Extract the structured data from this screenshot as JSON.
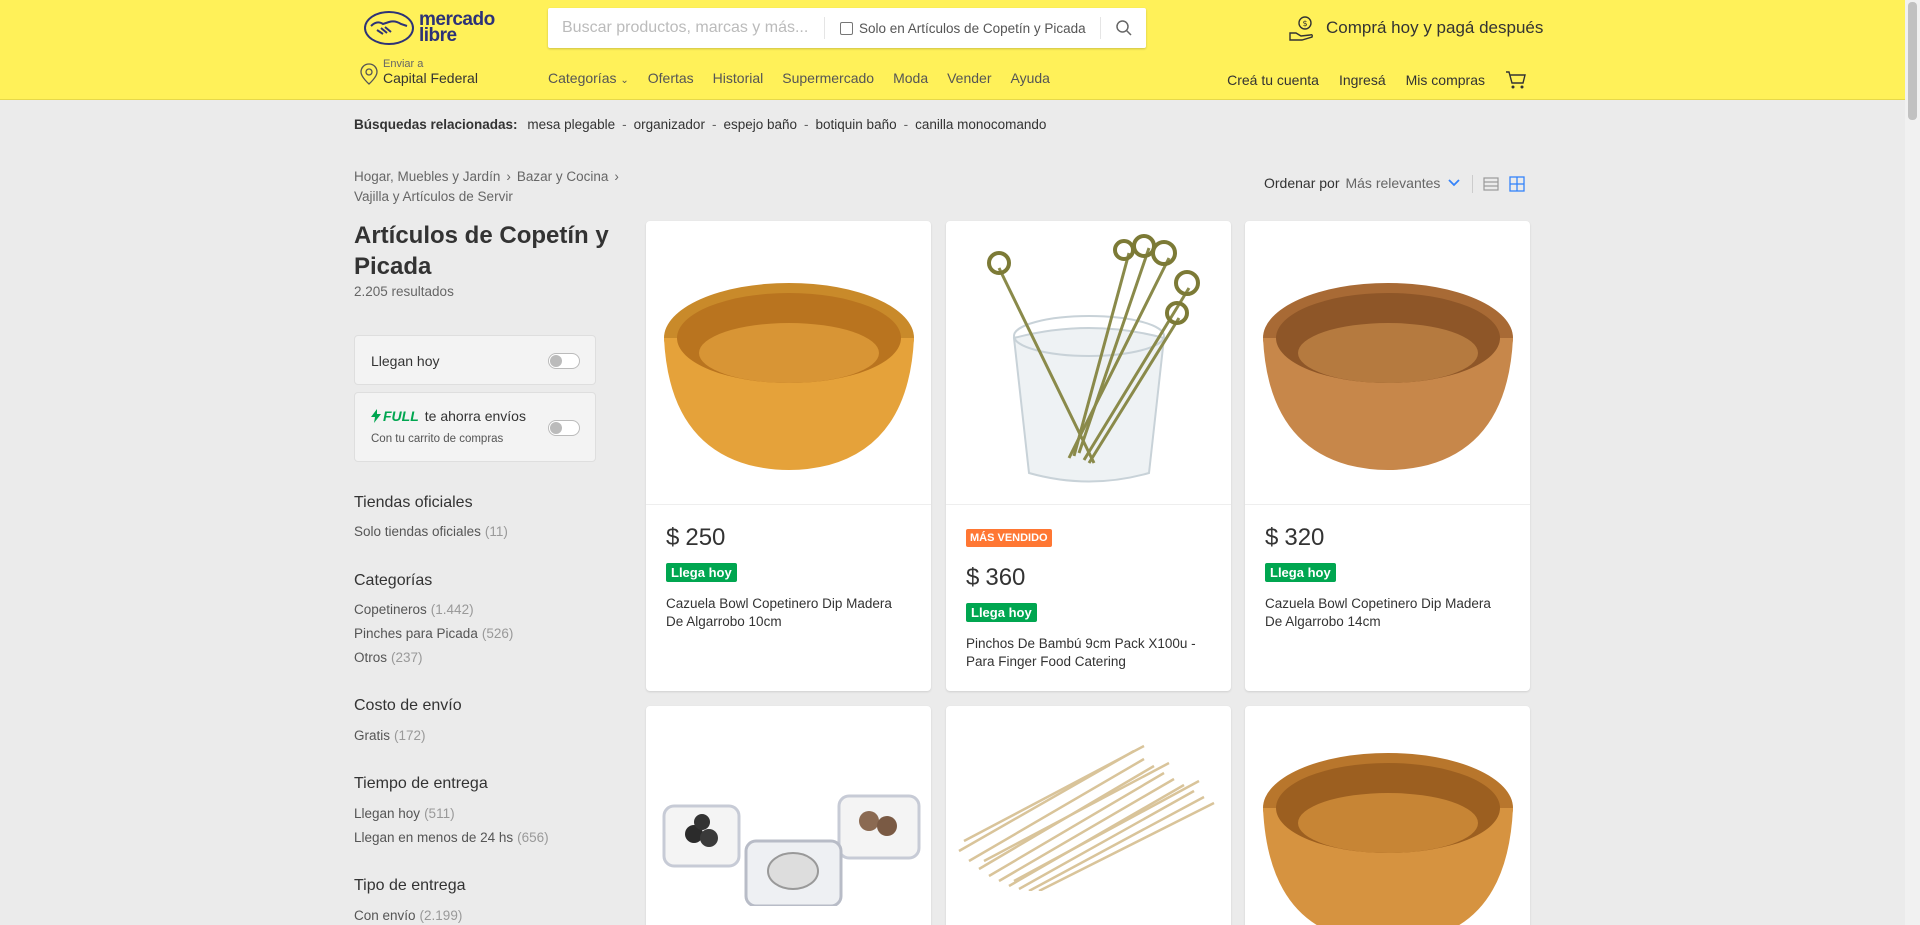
{
  "header": {
    "logo_text_1": "mercado",
    "logo_text_2": "libre",
    "search_placeholder": "Buscar productos, marcas y más...",
    "checkbox_label": "Solo en Artículos de Copetín y Picada",
    "promo": "Comprá hoy y pagá después",
    "location_label": "Enviar a",
    "location_value": "Capital Federal",
    "nav": [
      "Categorías",
      "Ofertas",
      "Historial",
      "Supermercado",
      "Moda",
      "Vender",
      "Ayuda"
    ],
    "account": [
      "Creá tu cuenta",
      "Ingresá",
      "Mis compras"
    ]
  },
  "related": {
    "label": "Búsquedas relacionadas:",
    "items": [
      "mesa plegable",
      "organizador",
      "espejo baño",
      "botiquin baño",
      "canilla monocomando"
    ]
  },
  "breadcrumb": [
    "Hogar, Muebles y Jardín",
    "Bazar y Cocina",
    "Vajilla y Artículos de Servir"
  ],
  "sort": {
    "label": "Ordenar por",
    "value": "Más relevantes"
  },
  "page": {
    "title": "Artículos de Copetín y Picada",
    "results": "2.205 resultados"
  },
  "filters": {
    "llegan_hoy": "Llegan hoy",
    "full_brand": "FULL",
    "full_text": "te ahorra envíos",
    "full_sub": "Con tu carrito de compras",
    "sections": [
      {
        "title": "Tiendas oficiales",
        "items": [
          {
            "label": "Solo tiendas oficiales",
            "count": "(11)"
          }
        ]
      },
      {
        "title": "Categorías",
        "items": [
          {
            "label": "Copetineros",
            "count": "(1.442)"
          },
          {
            "label": "Pinches para Picada",
            "count": "(526)"
          },
          {
            "label": "Otros",
            "count": "(237)"
          }
        ]
      },
      {
        "title": "Costo de envío",
        "items": [
          {
            "label": "Gratis",
            "count": "(172)"
          }
        ]
      },
      {
        "title": "Tiempo de entrega",
        "items": [
          {
            "label": "Llegan hoy",
            "count": "(511)"
          },
          {
            "label": "Llegan en menos de 24 hs",
            "count": "(656)"
          }
        ]
      },
      {
        "title": "Tipo de entrega",
        "items": [
          {
            "label": "Con envío",
            "count": "(2.199)"
          }
        ]
      }
    ]
  },
  "products": [
    {
      "price_currency": "$",
      "price_value": "250",
      "badge": "Llega hoy",
      "title": "Cazuela Bowl Copetinero Dip Madera De Algarrobo 10cm"
    },
    {
      "top_badge": "MÁS VENDIDO",
      "price_currency": "$",
      "price_value": "360",
      "badge": "Llega hoy",
      "title": "Pinchos De Bambú 9cm Pack X100u - Para Finger Food Catering"
    },
    {
      "price_currency": "$",
      "price_value": "320",
      "badge": "Llega hoy",
      "title": "Cazuela Bowl Copetinero Dip Madera De Algarrobo 14cm"
    }
  ],
  "colors": {
    "header_bg": "#fff159",
    "green": "#00a650",
    "orange": "#ff7733",
    "blue": "#3483fa",
    "brand_navy": "#2d3277"
  }
}
